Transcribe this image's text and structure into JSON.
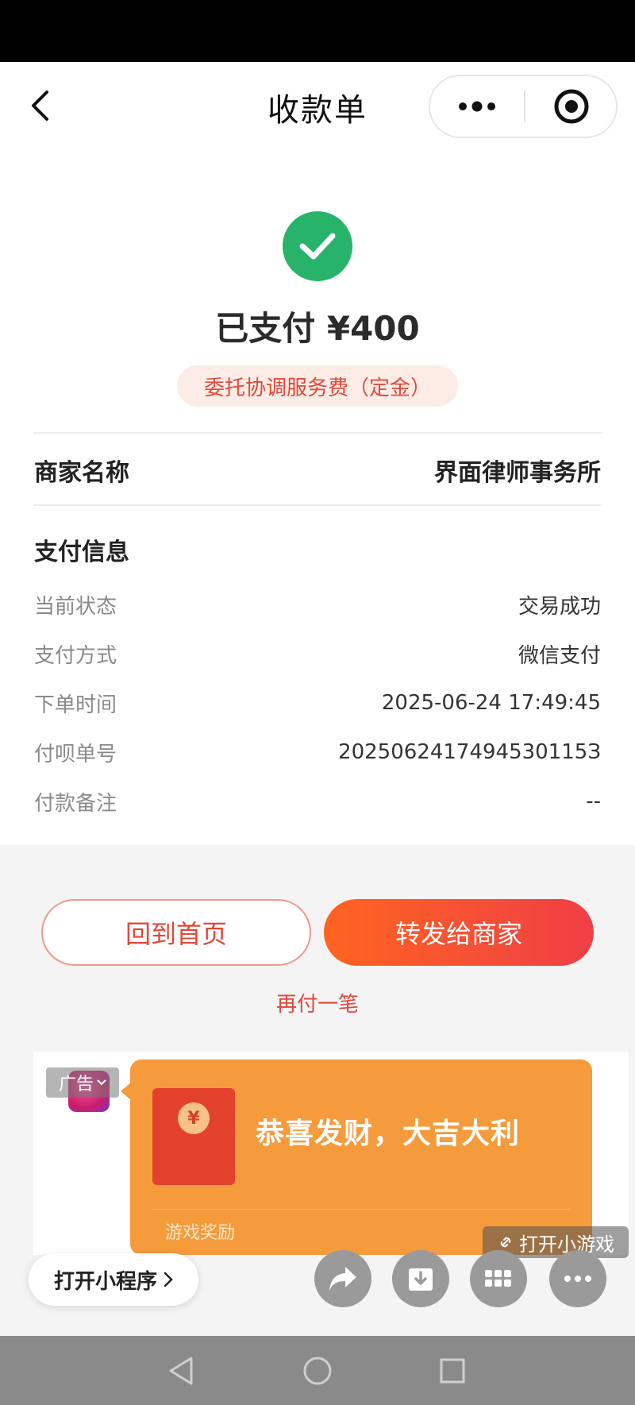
{
  "header": {
    "title": "收款单",
    "back_icon": "chevron-left-icon",
    "more_icon": "more-dots-icon",
    "close_icon": "record-target-icon"
  },
  "payment": {
    "status_icon": "check-circle-icon",
    "status_color": "#27b46a",
    "paid_label": "已支付 ¥400",
    "description": "委托协调服务费（定金）"
  },
  "merchant": {
    "label": "商家名称",
    "value": "界面律师事务所"
  },
  "pay_info": {
    "title": "支付信息",
    "rows": [
      {
        "label": "当前状态",
        "value": "交易成功"
      },
      {
        "label": "支付方式",
        "value": "微信支付"
      },
      {
        "label": "下单时间",
        "value": "2025-06-24 17:49:45"
      },
      {
        "label": "付呗单号",
        "value": "2025062417494530115З"
      },
      {
        "label": "付款备注",
        "value": "--"
      }
    ]
  },
  "actions": {
    "home": "回到首页",
    "forward": "转发给商家",
    "pay_again": "再付一笔",
    "accent": "#e0483a"
  },
  "ad": {
    "badge": "广告",
    "headline": "恭喜发财，大吉大利",
    "sub": "游戏奖励",
    "open_game": "打开小游戏",
    "coin_symbol": "¥"
  },
  "bottom_bar": {
    "open_mini_program": "打开小程序",
    "fab_icons": [
      "share-arrow-icon",
      "download-icon",
      "grid-apps-icon",
      "more-horizontal-icon"
    ]
  },
  "system_nav": {
    "icons": [
      "nav-back-triangle-icon",
      "nav-home-circle-icon",
      "nav-recents-square-icon"
    ]
  }
}
